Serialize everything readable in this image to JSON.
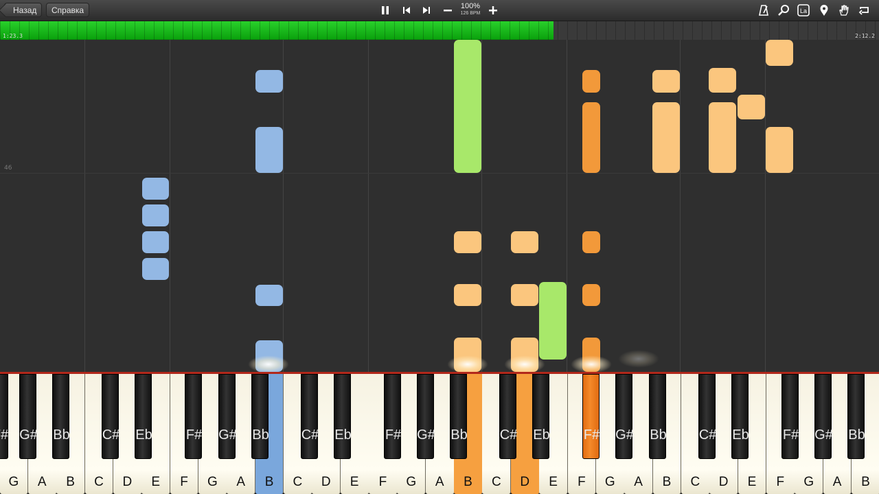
{
  "toolbar": {
    "back_label": "Назад",
    "help_label": "Справка",
    "speed_percent": "100%",
    "bpm": "126 BPM",
    "icons": [
      "pause-icon",
      "skip-back-icon",
      "skip-forward-icon",
      "minus-icon",
      "plus-icon",
      "metronome-icon",
      "search-icon",
      "la-icon",
      "location-pin-icon",
      "hand-icon",
      "loop-icon"
    ],
    "la_label": "La"
  },
  "progress": {
    "fraction": 0.63,
    "elapsed": "1:23.3",
    "total": "2:12.2"
  },
  "measure_label": "46",
  "colors": {
    "blue": "#93b8e4",
    "green": "#a8e86a",
    "light_orange": "#fbc67e",
    "orange": "#f2993a",
    "active_blue": "#7aa7dc",
    "active_orange": "#f6a040"
  },
  "keyboard": {
    "white_keys": [
      "G",
      "A",
      "B",
      "C",
      "D",
      "E",
      "F",
      "G",
      "A",
      "B",
      "C",
      "D",
      "E",
      "F",
      "G",
      "A",
      "B",
      "C",
      "D",
      "E",
      "F",
      "G",
      "A",
      "B",
      "C",
      "D",
      "E",
      "F",
      "G",
      "A",
      "B"
    ],
    "black_keys": [
      "F#",
      "G#",
      "Bb",
      "C#",
      "Eb",
      "F#",
      "G#",
      "Bb",
      "C#",
      "Eb",
      "F#",
      "G#",
      "Bb",
      "C#",
      "Eb",
      "F#",
      "G#",
      "Bb",
      "C#",
      "Eb",
      "F#",
      "G#",
      "Bb"
    ]
  }
}
